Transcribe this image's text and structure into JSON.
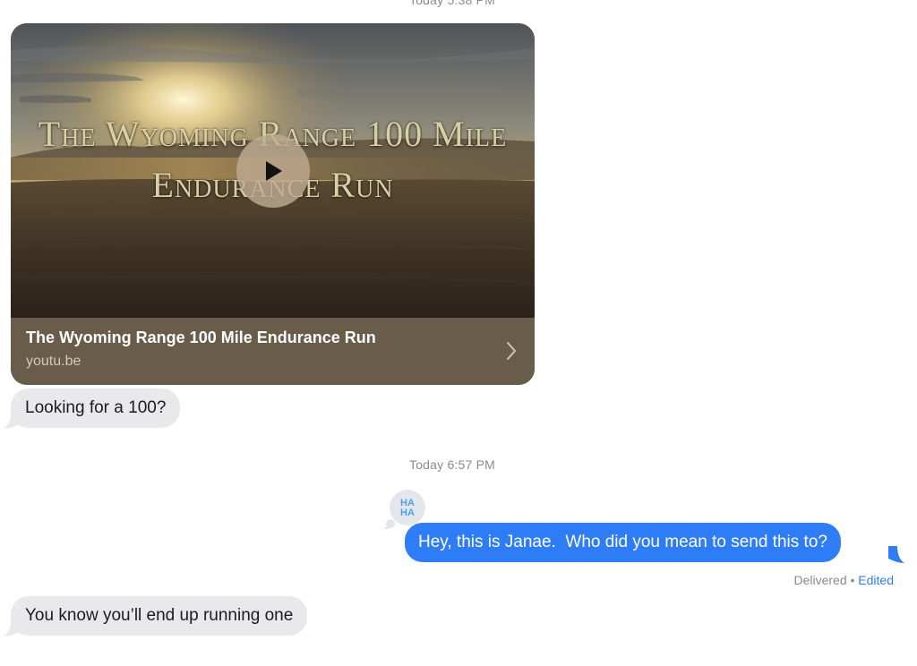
{
  "conversation": {
    "timestamps": {
      "first": "Today 5:38 PM",
      "second": "Today 6:57 PM"
    },
    "link_preview": {
      "video_title_line1": "The Wyoming Range 100 Mile",
      "video_title_line2": "Endurance Run",
      "title": "The Wyoming Range 100 Mile Endurance Run",
      "domain": "youtu.be"
    },
    "messages": [
      {
        "direction": "incoming",
        "text": "Looking for a 100?"
      },
      {
        "direction": "outgoing",
        "text": "Hey, this is Janae.  Who did you mean to send this to?"
      },
      {
        "direction": "incoming",
        "text": "You know you’ll end up running one"
      }
    ],
    "tapback": {
      "icon": "haha-tapback-icon",
      "text": "HA HA"
    },
    "status": {
      "delivered": "Delivered",
      "separator": "•",
      "edited": "Edited"
    }
  },
  "colors": {
    "outgoing_bubble": "#2f7df6",
    "incoming_bubble": "#e9e9eb",
    "card_footer": "#6a5c4a",
    "edited_link": "#2f7df6"
  }
}
